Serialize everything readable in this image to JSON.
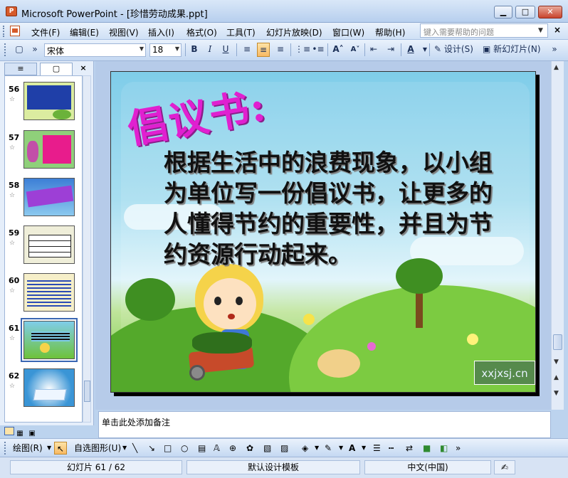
{
  "window": {
    "title": "Microsoft PowerPoint - [珍惜劳动成果.ppt]",
    "app_icon_letter": "P",
    "minimize": "▁",
    "maximize": "□",
    "close": "✕"
  },
  "menubar": {
    "items": [
      "文件(F)",
      "编辑(E)",
      "视图(V)",
      "插入(I)",
      "格式(O)",
      "工具(T)",
      "幻灯片放映(D)",
      "窗口(W)",
      "帮助(H)"
    ],
    "help_placeholder": "键入需要帮助的问题",
    "close_doc": "×"
  },
  "toolbar": {
    "font": "宋体",
    "size": "18",
    "bold": "B",
    "italic": "I",
    "underline": "U",
    "design_label": "设计(S)",
    "new_slide_label": "新幻灯片(N)"
  },
  "leftpane": {
    "tab_outline": "≡",
    "tab_slides": "▢",
    "close": "×",
    "slides": [
      {
        "num": "56"
      },
      {
        "num": "57"
      },
      {
        "num": "58"
      },
      {
        "num": "59"
      },
      {
        "num": "60"
      },
      {
        "num": "61"
      },
      {
        "num": "62"
      }
    ],
    "star": "☆"
  },
  "slide": {
    "title": "倡议书:",
    "body_lines": [
      "根据生活中的浪费现象，以小组",
      "为单位写一份倡议书，让更多的",
      "人懂得节约的重要性，并且为节",
      "约资源行动起来。"
    ],
    "watermark": "xxjxsj.cn"
  },
  "notes": {
    "placeholder": "单击此处添加备注"
  },
  "drawbar": {
    "draw_label": "绘图(R)",
    "autoshape_label": "自选图形(U)"
  },
  "status": {
    "slide_pos": "幻灯片 61 / 62",
    "template": "默认设计模板",
    "language": "中文(中国)"
  },
  "colors": {
    "title_magenta": "#e020d0",
    "selected_thumb": "#3a66b3"
  }
}
